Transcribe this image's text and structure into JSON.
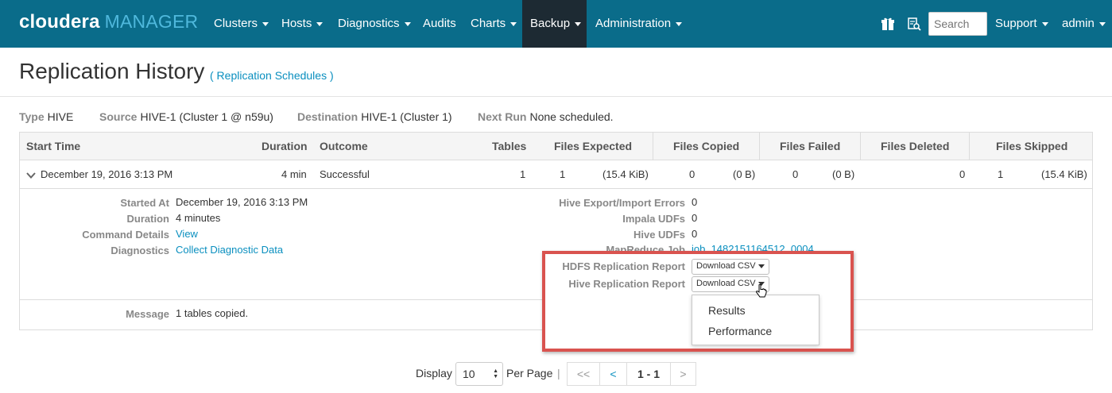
{
  "nav": {
    "brand": "cloudera",
    "product": "MANAGER",
    "items": [
      {
        "label": "Clusters",
        "caret": true
      },
      {
        "label": "Hosts",
        "caret": true
      },
      {
        "label": "Diagnostics",
        "caret": true
      },
      {
        "label": "Audits",
        "caret": false
      },
      {
        "label": "Charts",
        "caret": true
      },
      {
        "label": "Backup",
        "caret": true,
        "active": true
      },
      {
        "label": "Administration",
        "caret": true
      }
    ],
    "search_placeholder": "Search",
    "support": "Support",
    "user": "admin",
    "icons": [
      "gift-icon",
      "search-list-icon"
    ]
  },
  "page": {
    "title": "Replication History",
    "title_link": "( Replication Schedules )"
  },
  "meta": {
    "type_label": "Type",
    "type_value": "HIVE",
    "source_label": "Source",
    "source_value": "HIVE-1 (Cluster 1 @ n59u)",
    "dest_label": "Destination",
    "dest_value": "HIVE-1 (Cluster 1)",
    "next_label": "Next Run",
    "next_value": "None scheduled."
  },
  "table": {
    "headers": [
      "Start Time",
      "Duration",
      "Outcome",
      "Tables",
      "Files Expected",
      "Files Copied",
      "Files Failed",
      "Files Deleted",
      "Files Skipped"
    ],
    "row": {
      "start_time": "December 19, 2016 3:13 PM",
      "duration": "4 min",
      "outcome": "Successful",
      "tables": "1",
      "files_expected": "1",
      "files_expected_size": "(15.4 KiB)",
      "files_copied": "0",
      "files_copied_size": "(0 B)",
      "files_failed": "0",
      "files_failed_size": "(0 B)",
      "files_deleted": "0",
      "files_skipped": "1",
      "files_skipped_size": "(15.4 KiB)"
    }
  },
  "details": {
    "started_at_label": "Started At",
    "started_at": "December 19, 2016 3:13 PM",
    "duration_label": "Duration",
    "duration": "4 minutes",
    "command_label": "Command Details",
    "command_link": "View",
    "diagnostics_label": "Diagnostics",
    "diagnostics_link": "Collect Diagnostic Data",
    "errors_label": "Hive Export/Import Errors",
    "errors_value": "0",
    "impala_label": "Impala UDFs",
    "impala_value": "0",
    "hive_udfs_label": "Hive UDFs",
    "hive_udfs_value": "0",
    "mapreduce_label": "MapReduce Job",
    "mapreduce_value": "job_1482151164512_0004",
    "hdfs_report_label": "HDFS Replication Report",
    "hive_report_label": "Hive Replication Report",
    "download_label": "Download CSV",
    "menu_items": [
      "Results",
      "Performance"
    ],
    "message_label": "Message",
    "message_value": "1 tables copied."
  },
  "pager": {
    "display_label": "Display",
    "page_size": "10",
    "per_page_label": "Per Page",
    "separator": "|",
    "first": "<<",
    "prev": "<",
    "range": "1 - 1",
    "next": ">"
  }
}
